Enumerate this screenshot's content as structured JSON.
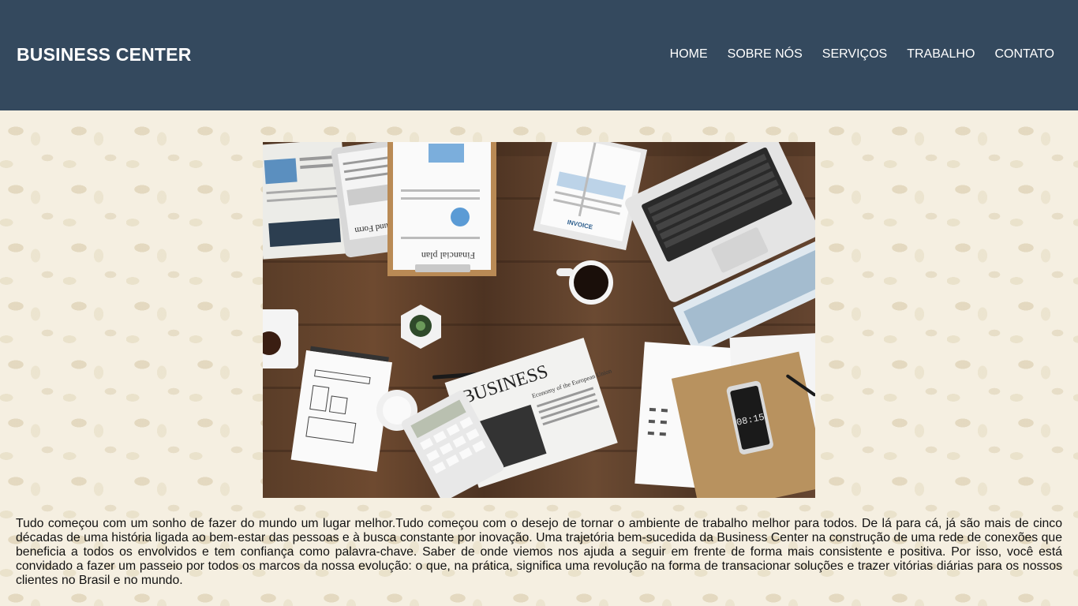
{
  "header": {
    "brand": "BUSINESS CENTER",
    "nav": [
      "HOME",
      "SOBRE NÓS",
      "SERVIÇOS",
      "TRABALHO",
      "CONTATO"
    ]
  },
  "hero": {
    "texts": {
      "tax_form": "Tax Refund Form",
      "financial_plan": "Financial plan",
      "invoice": "INVOICE",
      "newspaper": "BUSINESS",
      "newspaper_sub": "Economy of the European Union",
      "phone_time": "08:15"
    }
  },
  "content": {
    "paragraph": "Tudo começou com um sonho de fazer do mundo um lugar melhor.Tudo começou com o desejo de tornar o ambiente de trabalho melhor para todos. De lá para cá, já são mais de cinco décadas de uma história ligada ao bem-estar das pessoas e à busca constante por inovação. Uma trajetória bem-sucedida da Business Center na construção de uma rede de conexões que beneficia a todos os envolvidos e tem confiança como palavra-chave. Saber de onde viemos nos ajuda a seguir em frente de forma mais consistente e positiva. Por isso, você está convidado a fazer um passeio por todos os marcos da nossa evolução: o que, na prática, significa uma revolução na forma de transacionar soluções e trazer vitórias diárias para os nossos clientes no Brasil e no mundo."
  },
  "colors": {
    "header_bg": "#34495e",
    "page_bg": "#f5efe1",
    "text": "#111111"
  }
}
